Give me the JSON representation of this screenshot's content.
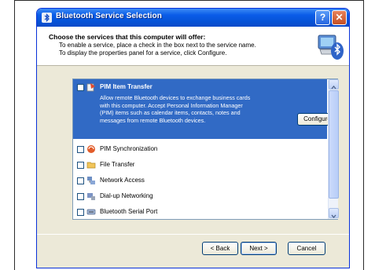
{
  "window": {
    "title": "Bluetooth Service Selection",
    "help_glyph": "?",
    "close_glyph": "✕"
  },
  "header": {
    "title": "Choose the services that this computer will offer:",
    "line1": "To enable a service, place a check in the box next to the service name.",
    "line2": "To display the properties panel for a service, click Configure.",
    "logo_icon": "bluetooth-computer-icon"
  },
  "services": [
    {
      "label": "PIM Item Transfer",
      "checked": false,
      "selected": true,
      "icon": "pim-transfer-icon",
      "description": [
        "Allow remote Bluetooth devices to exchange business cards",
        "with this computer. Accept Personal Information Manager",
        "(PIM) items such as calendar items, contacts, notes and",
        "messages from remote Bluetooth devices."
      ]
    },
    {
      "label": "PIM Synchronization",
      "checked": false,
      "icon": "pim-sync-icon"
    },
    {
      "label": "File Transfer",
      "checked": false,
      "icon": "folder-icon"
    },
    {
      "label": "Network Access",
      "checked": false,
      "icon": "network-icon"
    },
    {
      "label": "Dial-up Networking",
      "checked": false,
      "icon": "dialup-icon"
    },
    {
      "label": "Bluetooth Serial Port",
      "checked": false,
      "icon": "serial-port-icon"
    }
  ],
  "buttons": {
    "configure": "Configure",
    "back": "< Back",
    "next": "Next >",
    "cancel": "Cancel"
  },
  "colors": {
    "titlebar": "#0a5ce8",
    "selection": "#316ac5",
    "dialog_bg": "#ece9d8"
  }
}
